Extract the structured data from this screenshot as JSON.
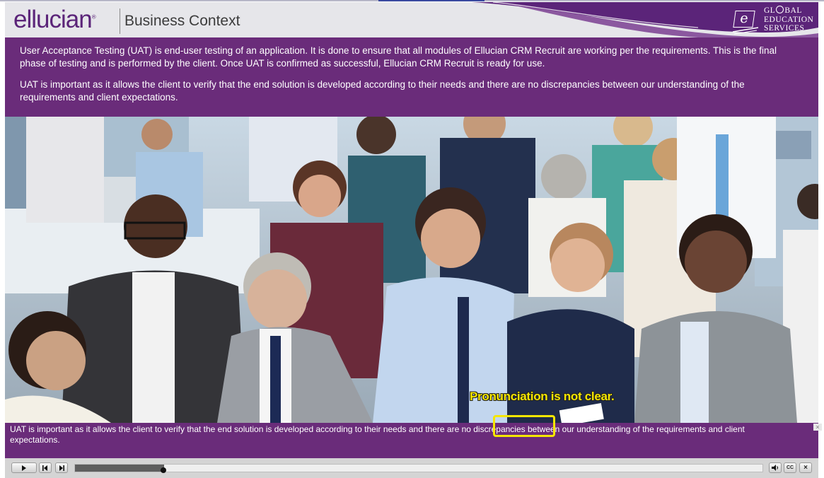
{
  "header": {
    "brand": "ellucian",
    "brand_mark": "®",
    "title": "Business Context",
    "ges_lines": [
      "GL",
      "BAL",
      "EDUCATION",
      "SERVICES"
    ],
    "ges_letter": "e"
  },
  "intro": {
    "paragraph1": "User Acceptance Testing (UAT) is end-user testing of an application. It is done to ensure that all modules of Ellucian CRM Recruit are working per the requirements. This is the final phase of testing and is performed by the client. Once UAT is confirmed as successful, Ellucian CRM Recruit is ready for use.",
    "paragraph2": "UAT is important as it allows the client to verify that the end solution is developed according to their needs and there are no discrepancies between our understanding of the requirements and client expectations."
  },
  "annotation": {
    "note": "Pronunciation is not clear.",
    "highlighted_word": "discrepancies"
  },
  "caption": {
    "text": "UAT is important as it allows the client to verify that the end solution is developed according to their needs and there are no discrepancies between our understanding of the requirements and client expectations.",
    "close_label": "×"
  },
  "player": {
    "play_icon": "play-icon",
    "progress": 0.13,
    "cc_label": "CC",
    "close_label": "×"
  },
  "colors": {
    "brand_purple": "#6a2c7a",
    "logo_purple": "#5b2479",
    "annotation_yellow": "#f5e600"
  }
}
